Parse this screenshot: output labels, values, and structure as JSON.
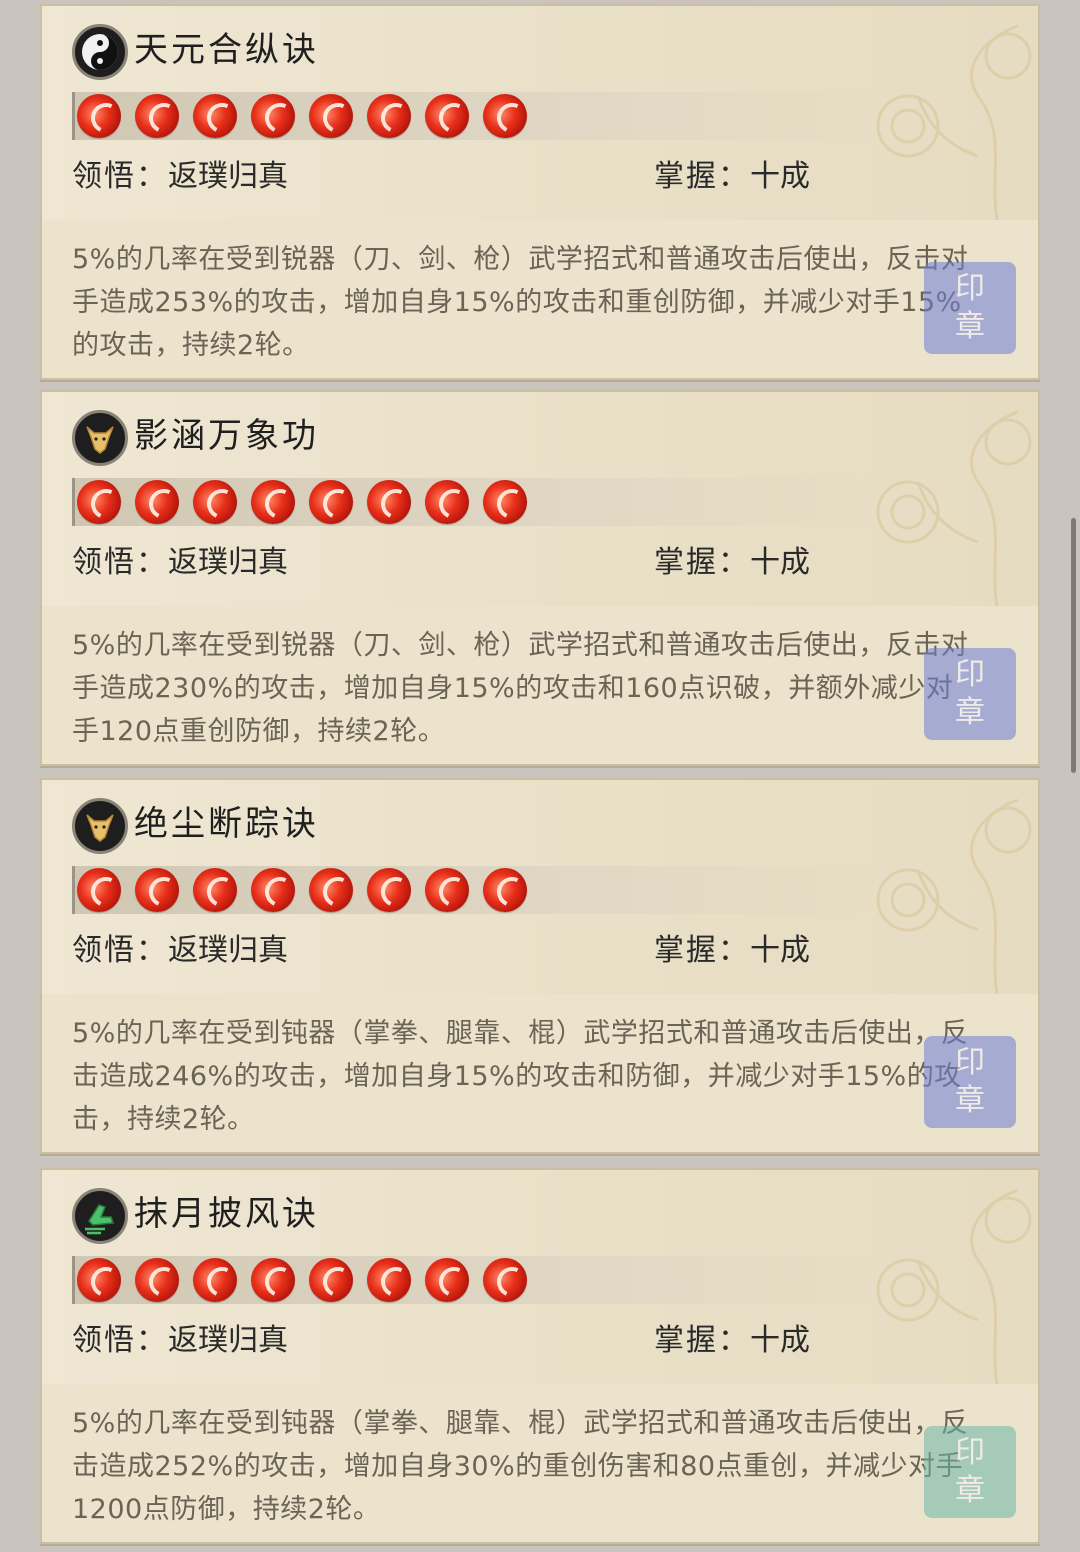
{
  "skills": [
    {
      "name": "天元合纵诀",
      "icon": "taiji-icon",
      "orbs": 8,
      "comprehension_label": "领悟：",
      "comprehension_value": "返璞归真",
      "mastery_label": "掌握：",
      "mastery_value": "十成",
      "description": "5%的几率在受到锐器（刀、剑、枪）武学招式和普通攻击后使出，反击对手造成253%的攻击，增加自身15%的攻击和重创防御，并减少对手15%的攻击，持续2轮。",
      "seal_color": "#6c7fd6"
    },
    {
      "name": "影涵万象功",
      "icon": "bull-head-icon",
      "orbs": 8,
      "comprehension_label": "领悟：",
      "comprehension_value": "返璞归真",
      "mastery_label": "掌握：",
      "mastery_value": "十成",
      "description": "5%的几率在受到锐器（刀、剑、枪）武学招式和普通攻击后使出，反击对手造成230%的攻击，增加自身15%的攻击和160点识破，并额外减少对手120点重创防御，持续2轮。",
      "seal_color": "#6c7fd6"
    },
    {
      "name": "绝尘断踪诀",
      "icon": "bull-head-icon",
      "orbs": 8,
      "comprehension_label": "领悟：",
      "comprehension_value": "返璞归真",
      "mastery_label": "掌握：",
      "mastery_value": "十成",
      "description": "5%的几率在受到钝器（掌拳、腿靠、棍）武学招式和普通攻击后使出，反击造成246%的攻击，增加自身15%的攻击和防御，并减少对手15%的攻击，持续2轮。",
      "seal_color": "#6c7fd6"
    },
    {
      "name": "抹月披风诀",
      "icon": "wind-boot-icon",
      "orbs": 8,
      "comprehension_label": "领悟：",
      "comprehension_value": "返璞归真",
      "mastery_label": "掌握：",
      "mastery_value": "十成",
      "description": "5%的几率在受到钝器（掌拳、腿靠、棍）武学招式和普通攻击后使出，反击造成252%的攻击，增加自身30%的重创伤害和80点重创，并减少对手1200点防御，持续2轮。",
      "seal_color": "#6cb6a6"
    }
  ]
}
